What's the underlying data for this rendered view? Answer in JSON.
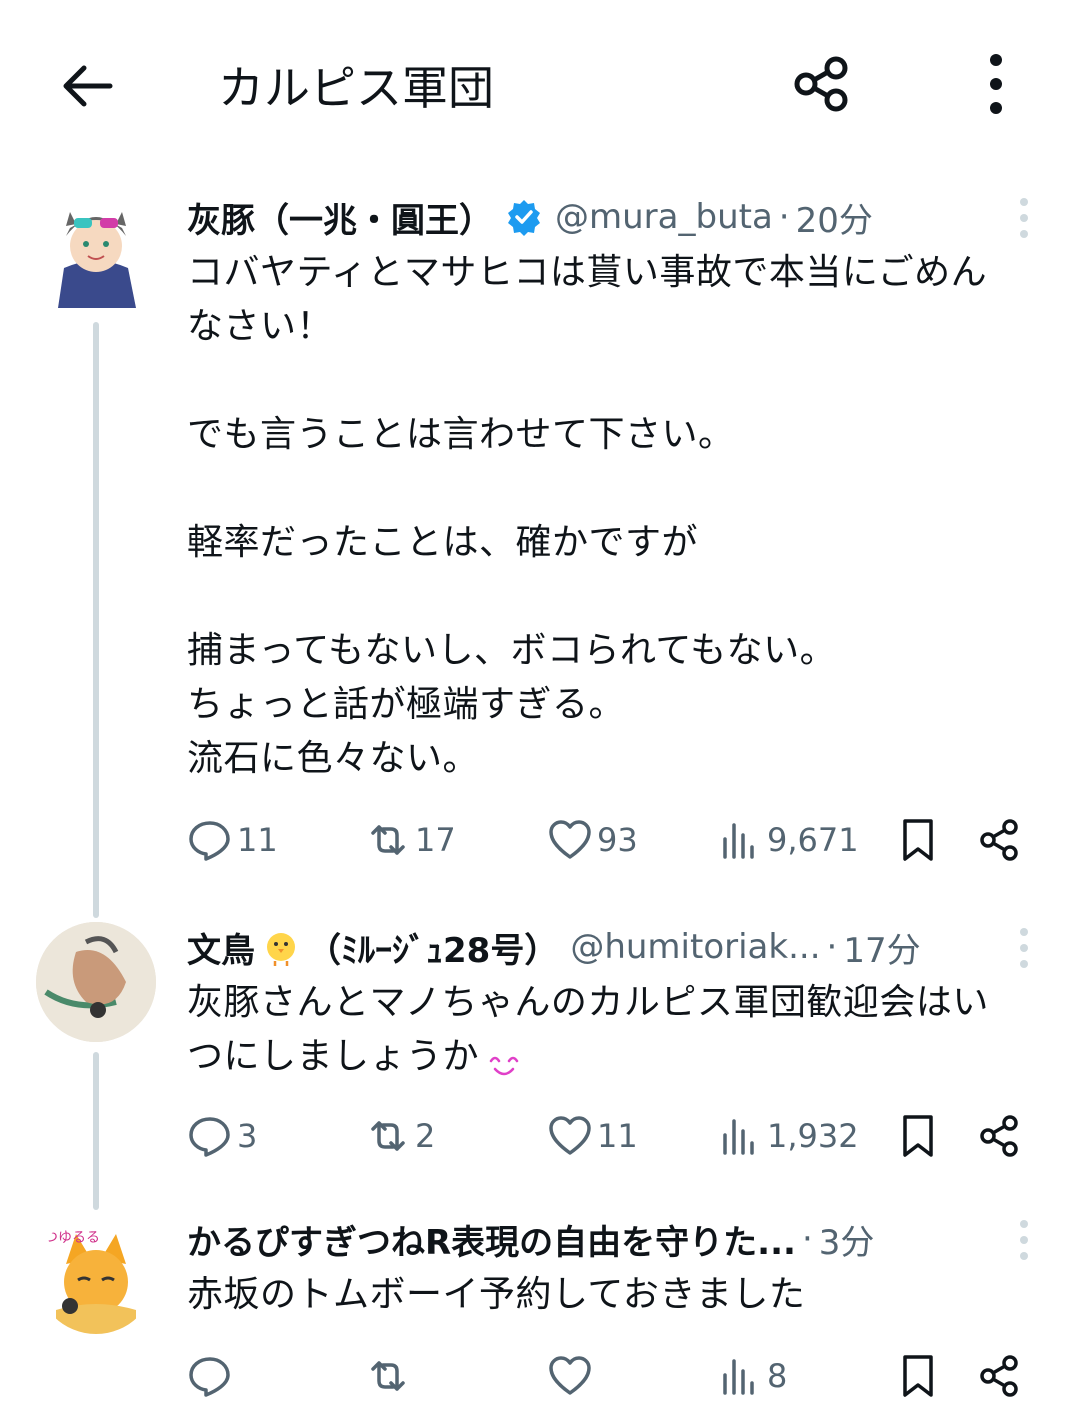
{
  "app": {
    "title": "カルピス軍団"
  },
  "tweets": [
    {
      "name": "灰豚（一兆・圓王）",
      "verified": true,
      "handle": "@mura_buta",
      "separator": "·",
      "time": "20分",
      "text": "コバヤティとマサヒコは貰い事故で本当にごめん\nなさい！\n\nでも言うことは言わせて下さい。\n\n軽率だったことは、確かですが\n\n捕まってもないし、ボコられてもない。\nちょっと話が極端すぎる。\n流石に色々ない。",
      "replies": "11",
      "retweets": "17",
      "likes": "93",
      "views": "9,671"
    },
    {
      "name": "文鳥",
      "name_suffix": "（ﾐﾙｰｼﾞｭ28号）",
      "emoji": "chick-emoji",
      "handle": "@humitoriak...",
      "separator": "·",
      "time": "17分",
      "text": "灰豚さんとマノちゃんのカルピス軍団歓迎会はい\nつにしましょうか",
      "replies": "3",
      "retweets": "2",
      "likes": "11",
      "views": "1,932"
    },
    {
      "name": "かるぴすぎつねR表現の自由を守りた...",
      "separator": "·",
      "time": "3分",
      "text": "赤坂のトムボーイ予約しておきました",
      "replies": "",
      "retweets": "",
      "likes": "",
      "views": "8"
    }
  ],
  "colors": {
    "text": "#0f1419",
    "secondary": "#536471",
    "verified_blue": "#1d9bf0",
    "thread_line": "#cfd9de"
  }
}
